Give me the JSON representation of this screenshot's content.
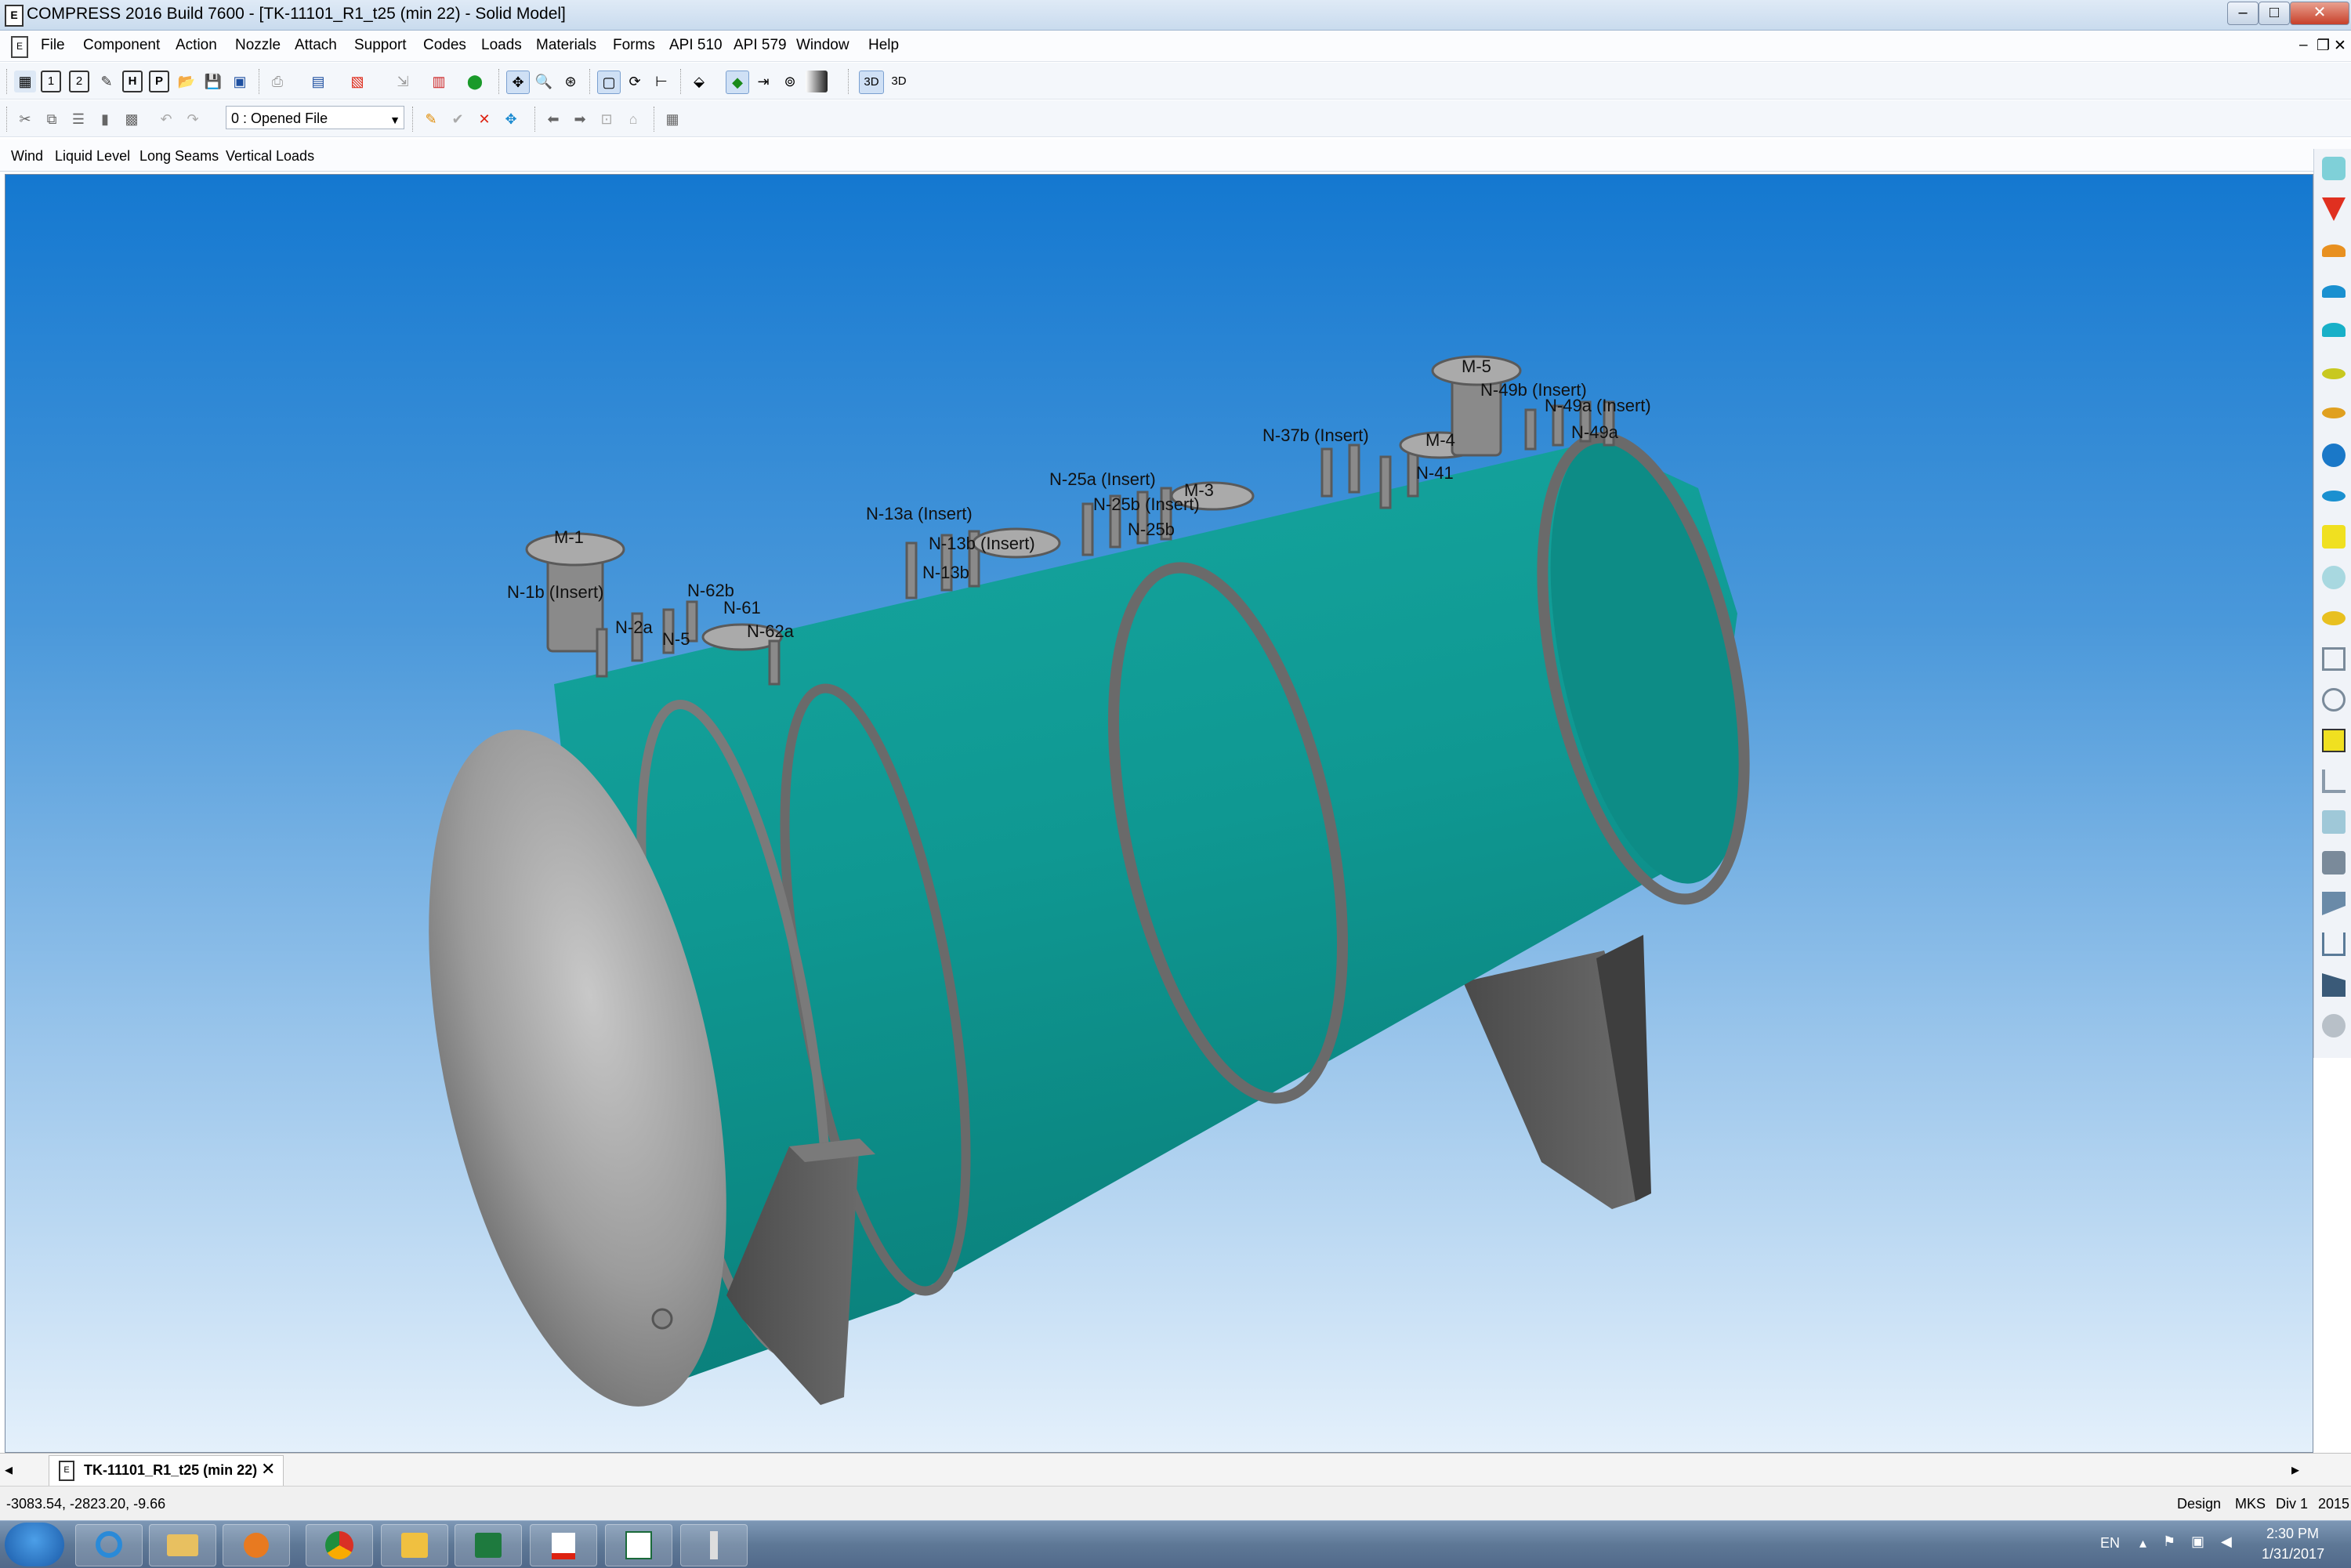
{
  "window": {
    "title": "COMPRESS 2016 Build 7600 - [TK-11101_R1_t25 (min 22) - Solid Model]",
    "minimize": "–",
    "maximize": "□",
    "close": "✕",
    "mdi_minimize": "–",
    "mdi_restore": "❐",
    "mdi_close": "✕"
  },
  "menu": [
    "File",
    "Component",
    "Action",
    "Nozzle",
    "Attach",
    "Support",
    "Codes",
    "Loads",
    "Materials",
    "Forms",
    "API 510",
    "API 579",
    "Window",
    "Help"
  ],
  "toolbar": {
    "view_2d": "3D",
    "view_3d": "3D",
    "file_combo": "0 : Opened File",
    "btn_1": "1",
    "btn_2": "2",
    "btn_h": "H",
    "btn_p": "P"
  },
  "subtabs": [
    "Wind",
    "Liquid Level",
    "Long Seams",
    "Vertical Loads"
  ],
  "model_labels": {
    "m1": "M-1",
    "n1b": "N-1b (Insert)",
    "n2a": "N-2a",
    "n5": "N-5",
    "n62b": "N-62b",
    "n61": "N-61",
    "n62a": "N-62a",
    "n13a": "N-13a (Insert)",
    "n13b": "N-13b (Insert)",
    "n13b_short": "N-13b",
    "n25a": "N-25a (Insert)",
    "n25b": "N-25b (Insert)",
    "n25b_short": "N-25b",
    "m3": "M-3",
    "n37b": "N-37b (Insert)",
    "m4": "M-4",
    "n41": "N-41",
    "m5": "M-5",
    "n49b": "N-49b (Insert)",
    "n49a": "N-49a (Insert)",
    "n49a_short": "N-49a"
  },
  "doc_tab": {
    "label": "TK-11101_R1_t25 (min 22)",
    "close": "✕"
  },
  "status": {
    "coords": "-3083.54, -2823.20, -9.66",
    "mode": "Design",
    "units": "MKS",
    "division": "Div 1",
    "year": "2015"
  },
  "taskbar": {
    "lang": "EN",
    "time": "2:30 PM",
    "date": "1/31/2017"
  },
  "colors": {
    "shell": "#0f9892",
    "head": "#9a9a9a",
    "saddle": "#5a5a5a",
    "viewport_top": "#1478d0",
    "viewport_bottom": "#e4f0fb"
  }
}
